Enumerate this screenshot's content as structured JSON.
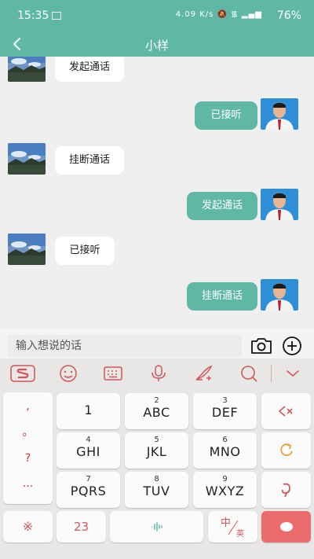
{
  "status_bar": {
    "time": "15:35",
    "network_speed": "4.09 K/s",
    "battery": "76%"
  },
  "app_bar": {
    "title": "小样"
  },
  "messages": [
    {
      "side": "left",
      "text": "发起通话"
    },
    {
      "side": "right",
      "text": "已接听"
    },
    {
      "side": "left",
      "text": "挂断通话"
    },
    {
      "side": "right",
      "text": "发起通话"
    },
    {
      "side": "left",
      "text": "已接听"
    },
    {
      "side": "right",
      "text": "挂断通话"
    }
  ],
  "input": {
    "placeholder": "输入想说的话"
  },
  "keyboard": {
    "punctuation": [
      ",",
      "。",
      "?",
      "..."
    ],
    "keys": [
      {
        "num": "",
        "letters": "1"
      },
      {
        "num": "2",
        "letters": "ABC"
      },
      {
        "num": "3",
        "letters": "DEF"
      },
      {
        "num": "4",
        "letters": "GHI"
      },
      {
        "num": "5",
        "letters": "JKL"
      },
      {
        "num": "6",
        "letters": "MNO"
      },
      {
        "num": "7",
        "letters": "PQRS"
      },
      {
        "num": "8",
        "letters": "TUV"
      },
      {
        "num": "9",
        "letters": "WXYZ"
      }
    ],
    "symbol_key": "※",
    "number_key": "23",
    "lang_key_cn": "中",
    "lang_key_en": "英",
    "accent_color": "#ec6b6b",
    "icon_color": "#d0575a"
  },
  "colors": {
    "brand": "#5fb8a6",
    "bubble_left": "#ffffff",
    "bubble_right": "#5fb8a6"
  }
}
